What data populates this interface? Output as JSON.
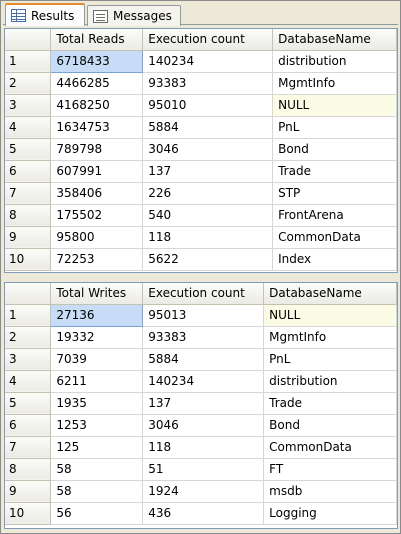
{
  "tabs": [
    {
      "label": "Results",
      "icon": "grid-icon",
      "active": true
    },
    {
      "label": "Messages",
      "icon": "messages-icon",
      "active": false
    }
  ],
  "grid1": {
    "columns": [
      "Total Reads",
      "Execution count",
      "DatabaseName"
    ],
    "rows": [
      {
        "n": "1",
        "a": "6718433",
        "b": "140234",
        "c": "distribution"
      },
      {
        "n": "2",
        "a": "4466285",
        "b": "93383",
        "c": "MgmtInfo"
      },
      {
        "n": "3",
        "a": "4168250",
        "b": "95010",
        "c": "NULL"
      },
      {
        "n": "4",
        "a": "1634753",
        "b": "5884",
        "c": "PnL"
      },
      {
        "n": "5",
        "a": "789798",
        "b": "3046",
        "c": "Bond"
      },
      {
        "n": "6",
        "a": "607991",
        "b": "137",
        "c": "Trade"
      },
      {
        "n": "7",
        "a": "358406",
        "b": "226",
        "c": "STP"
      },
      {
        "n": "8",
        "a": "175502",
        "b": "540",
        "c": "FrontArena"
      },
      {
        "n": "9",
        "a": "95800",
        "b": "118",
        "c": "CommonData"
      },
      {
        "n": "10",
        "a": "72253",
        "b": "5622",
        "c": "Index"
      }
    ]
  },
  "grid2": {
    "columns": [
      "Total Writes",
      "Execution count",
      "DatabaseName"
    ],
    "rows": [
      {
        "n": "1",
        "a": "27136",
        "b": "95013",
        "c": "NULL"
      },
      {
        "n": "2",
        "a": "19332",
        "b": "93383",
        "c": "MgmtInfo"
      },
      {
        "n": "3",
        "a": "7039",
        "b": "5884",
        "c": "PnL"
      },
      {
        "n": "4",
        "a": "6211",
        "b": "140234",
        "c": "distribution"
      },
      {
        "n": "5",
        "a": "1935",
        "b": "137",
        "c": "Trade"
      },
      {
        "n": "6",
        "a": "1253",
        "b": "3046",
        "c": "Bond"
      },
      {
        "n": "7",
        "a": "125",
        "b": "118",
        "c": "CommonData"
      },
      {
        "n": "8",
        "a": "58",
        "b": "51",
        "c": "FT"
      },
      {
        "n": "9",
        "a": "58",
        "b": "1924",
        "c": "msdb"
      },
      {
        "n": "10",
        "a": "56",
        "b": "436",
        "c": "Logging"
      }
    ]
  }
}
